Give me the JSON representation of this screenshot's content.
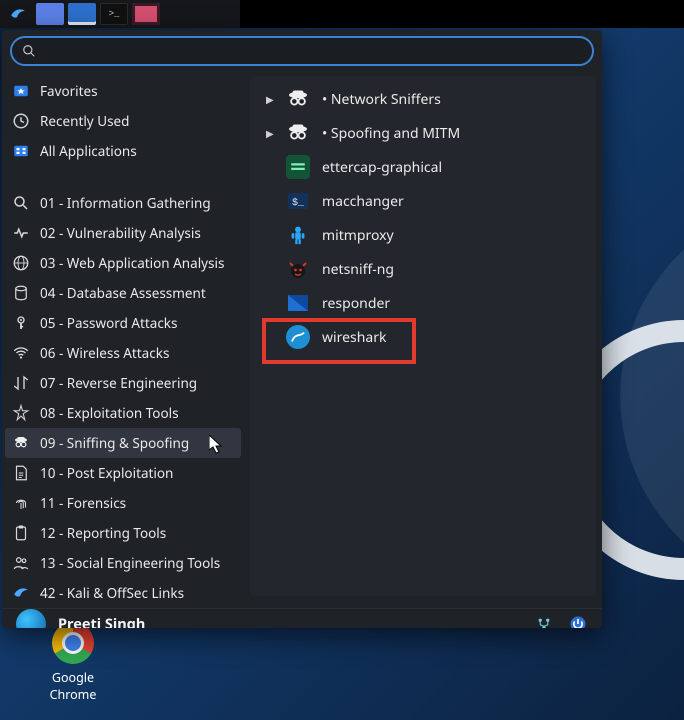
{
  "search": {
    "placeholder": ""
  },
  "pins": {
    "favorites": "Favorites",
    "recent": "Recently Used",
    "allapps": "All Applications"
  },
  "categories": [
    {
      "label": "01 - Information Gathering"
    },
    {
      "label": "02 - Vulnerability Analysis"
    },
    {
      "label": "03 - Web Application Analysis"
    },
    {
      "label": "04 - Database Assessment"
    },
    {
      "label": "05 - Password Attacks"
    },
    {
      "label": "06 - Wireless Attacks"
    },
    {
      "label": "07 - Reverse Engineering"
    },
    {
      "label": "08 - Exploitation Tools"
    },
    {
      "label": "09 - Sniffing & Spoofing",
      "selected": true
    },
    {
      "label": "10 - Post Exploitation"
    },
    {
      "label": "11 - Forensics"
    },
    {
      "label": "12 - Reporting Tools"
    },
    {
      "label": "13 - Social Engineering Tools"
    },
    {
      "label": "42 - Kali & OffSec Links"
    }
  ],
  "subgroups": [
    {
      "label": "Network Sniffers",
      "icon": "spy-icon",
      "expandable": true
    },
    {
      "label": "Spoofing and MITM",
      "icon": "spy-icon",
      "expandable": true
    }
  ],
  "apps": [
    {
      "label": "ettercap-graphical",
      "icon": "ettercap-icon",
      "color": "#1a7f53"
    },
    {
      "label": "macchanger",
      "icon": "terminal-icon",
      "color": "#1f6ed1"
    },
    {
      "label": "mitmproxy",
      "icon": "person-icon",
      "color": "#2aa6ff"
    },
    {
      "label": "netsniff-ng",
      "icon": "devil-icon",
      "color": "#222"
    },
    {
      "label": "responder",
      "icon": "responder-icon",
      "color": "#1f6ed1"
    },
    {
      "label": "wireshark",
      "icon": "wireshark-icon",
      "color": "#1f8fd3",
      "highlighted": true
    }
  ],
  "user": {
    "name": "Preeti Singh"
  },
  "desktop_icons": {
    "chrome": "Google Chrome"
  },
  "colors": {
    "accent_blue": "#3b82d6",
    "highlight_red": "#e23a2f",
    "panel_bg": "#1f2227",
    "panel_sub_bg": "#23262c"
  }
}
